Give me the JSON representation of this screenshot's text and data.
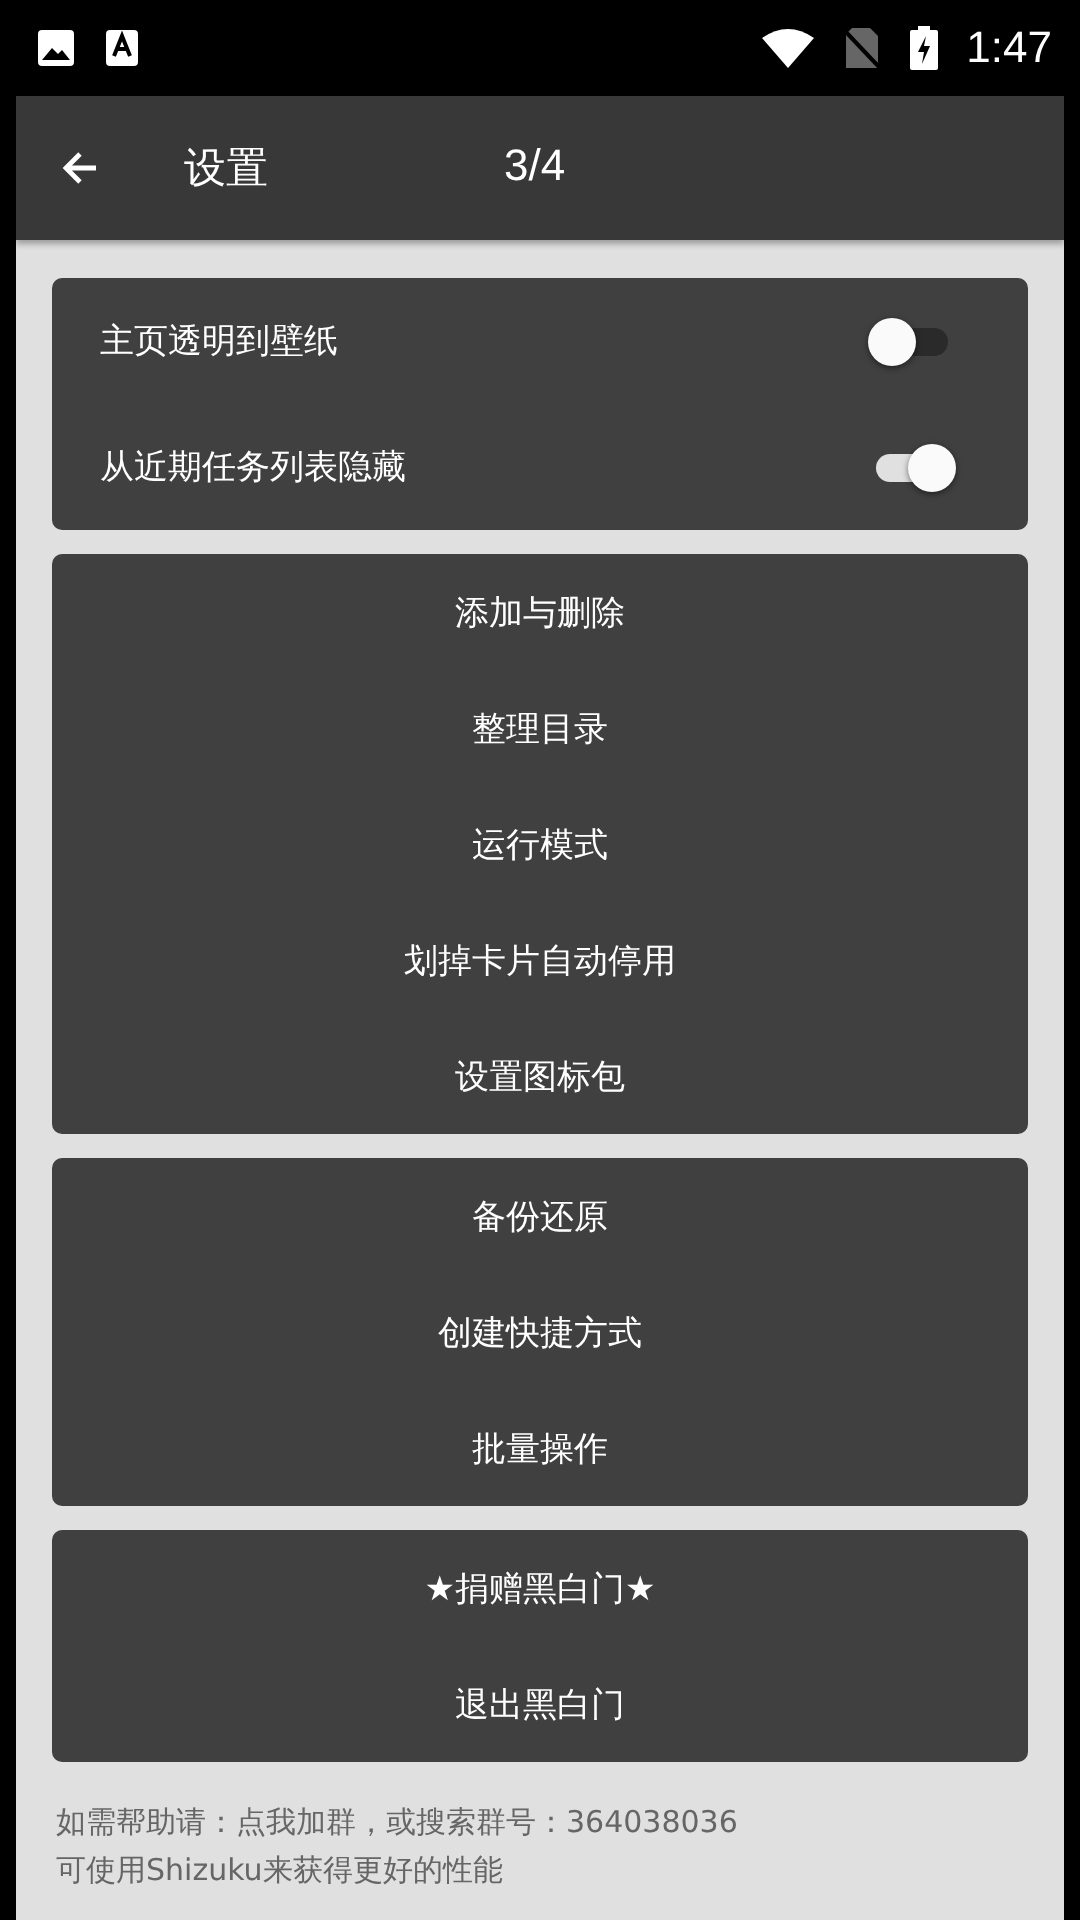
{
  "status_bar": {
    "time": "1:47"
  },
  "toolbar": {
    "title": "设置",
    "page": "3/4"
  },
  "toggles": [
    {
      "label": "主页透明到壁纸",
      "on": false
    },
    {
      "label": "从近期任务列表隐藏",
      "on": true
    }
  ],
  "groups": [
    [
      "添加与删除",
      "整理目录",
      "运行模式",
      "划掉卡片自动停用",
      "设置图标包"
    ],
    [
      "备份还原",
      "创建快捷方式",
      "批量操作"
    ],
    [
      "★捐赠黑白门★",
      "退出黑白门"
    ]
  ],
  "footer": [
    "如需帮助请：点我加群，或搜索群号：364038036",
    "可使用Shizuku来获得更好的性能"
  ]
}
